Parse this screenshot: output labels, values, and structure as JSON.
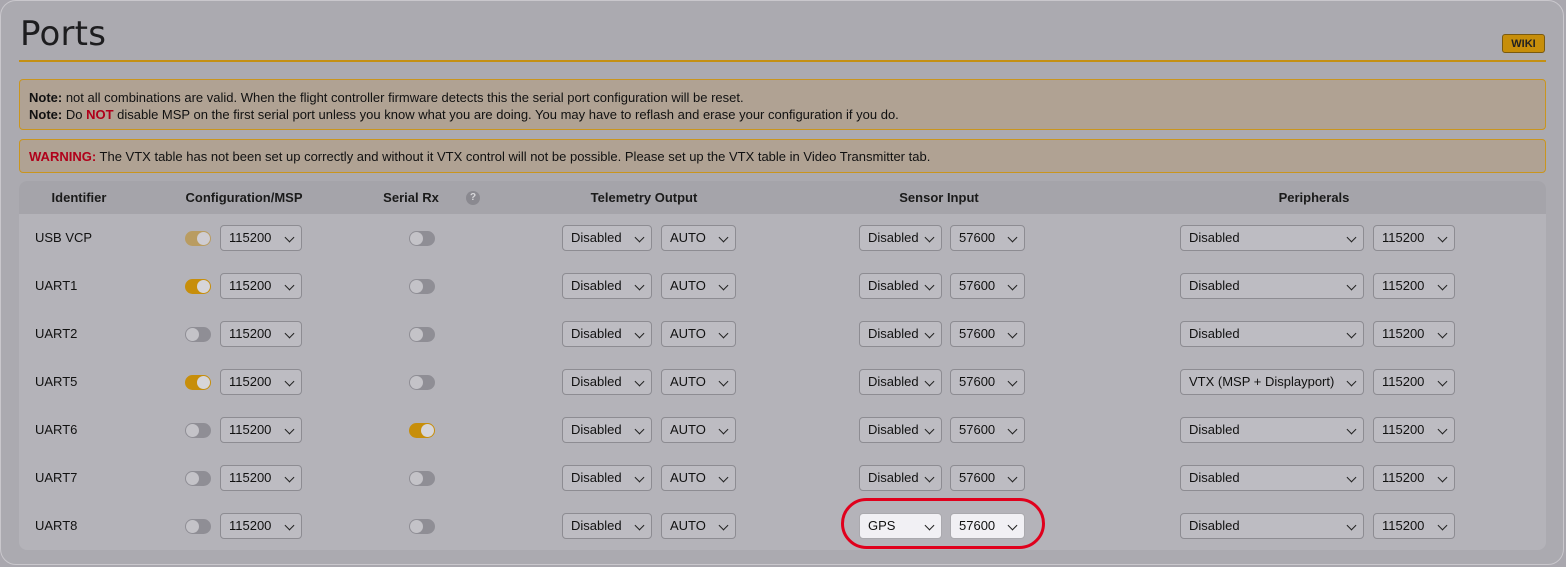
{
  "page": {
    "title": "Ports",
    "wiki_label": "WIKI"
  },
  "notes": {
    "line1_prefix": "Note:",
    "line1_text": " not all combinations are valid. When the flight controller firmware detects this the serial port configuration will be reset.",
    "line2_prefix": "Note:",
    "line2_text_a": " Do ",
    "line2_not": "NOT",
    "line2_text_b": " disable MSP on the first serial port unless you know what you are doing. You may have to reflash and erase your configuration if you do."
  },
  "warning": {
    "prefix": "WARNING:",
    "text": " The VTX table has not been set up correctly and without it VTX control will not be possible. Please set up the VTX table in Video Transmitter tab."
  },
  "table": {
    "headers": {
      "identifier": "Identifier",
      "config": "Configuration/MSP",
      "serial_rx": "Serial Rx",
      "help_glyph": "?",
      "telemetry": "Telemetry Output",
      "sensor": "Sensor Input",
      "peripherals": "Peripherals"
    },
    "rows": [
      {
        "id": "USB VCP",
        "msp": "dim",
        "msp_baud": "115200",
        "rx": false,
        "telemetry": "Disabled",
        "telemetry_baud": "AUTO",
        "sensor": "Disabled",
        "sensor_baud": "57600",
        "peripheral": "Disabled",
        "peripheral_baud": "115200"
      },
      {
        "id": "UART1",
        "msp": "on",
        "msp_baud": "115200",
        "rx": false,
        "telemetry": "Disabled",
        "telemetry_baud": "AUTO",
        "sensor": "Disabled",
        "sensor_baud": "57600",
        "peripheral": "Disabled",
        "peripheral_baud": "115200"
      },
      {
        "id": "UART2",
        "msp": "off",
        "msp_baud": "115200",
        "rx": false,
        "telemetry": "Disabled",
        "telemetry_baud": "AUTO",
        "sensor": "Disabled",
        "sensor_baud": "57600",
        "peripheral": "Disabled",
        "peripheral_baud": "115200"
      },
      {
        "id": "UART5",
        "msp": "on",
        "msp_baud": "115200",
        "rx": false,
        "telemetry": "Disabled",
        "telemetry_baud": "AUTO",
        "sensor": "Disabled",
        "sensor_baud": "57600",
        "peripheral": "VTX (MSP + Displayport)",
        "peripheral_baud": "115200"
      },
      {
        "id": "UART6",
        "msp": "off",
        "msp_baud": "115200",
        "rx": true,
        "telemetry": "Disabled",
        "telemetry_baud": "AUTO",
        "sensor": "Disabled",
        "sensor_baud": "57600",
        "peripheral": "Disabled",
        "peripheral_baud": "115200"
      },
      {
        "id": "UART7",
        "msp": "off",
        "msp_baud": "115200",
        "rx": false,
        "telemetry": "Disabled",
        "telemetry_baud": "AUTO",
        "sensor": "Disabled",
        "sensor_baud": "57600",
        "peripheral": "Disabled",
        "peripheral_baud": "115200"
      },
      {
        "id": "UART8",
        "msp": "off",
        "msp_baud": "115200",
        "rx": false,
        "telemetry": "Disabled",
        "telemetry_baud": "AUTO",
        "sensor": "GPS",
        "sensor_baud": "57600",
        "peripheral": "Disabled",
        "peripheral_baud": "115200"
      }
    ]
  },
  "colors": {
    "accent": "#c78e0a",
    "highlight_ring": "#e0001c",
    "warning_text": "#b0001a"
  }
}
